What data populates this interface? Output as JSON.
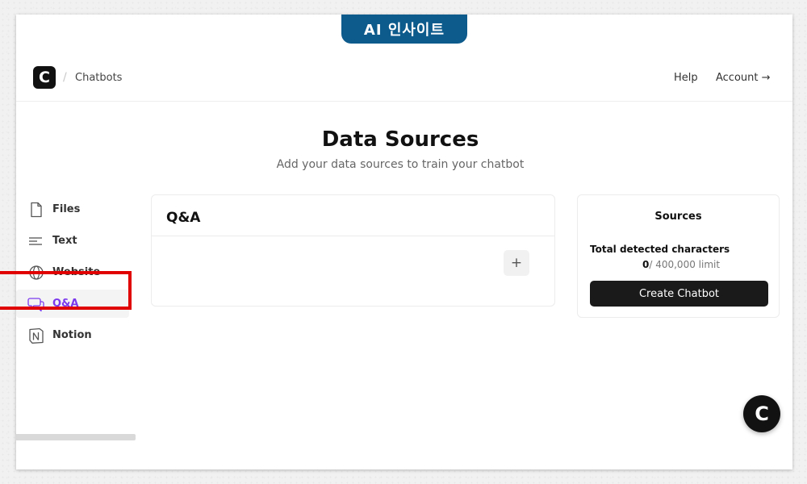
{
  "watermark": {
    "label": "AI 인사이트"
  },
  "topbar": {
    "logo_letter": "C",
    "separator": "/",
    "breadcrumb": "Chatbots",
    "help": "Help",
    "account": "Account →"
  },
  "header": {
    "title": "Data Sources",
    "subtitle": "Add your data sources to train your chatbot"
  },
  "sidebar": {
    "items": [
      {
        "label": "Files",
        "icon": "file-icon"
      },
      {
        "label": "Text",
        "icon": "text-lines-icon"
      },
      {
        "label": "Website",
        "icon": "globe-icon"
      },
      {
        "label": "Q&A",
        "icon": "chat-bubbles-icon",
        "active": true
      },
      {
        "label": "Notion",
        "icon": "notion-icon"
      }
    ]
  },
  "qa_panel": {
    "title": "Q&A",
    "add_label": "+"
  },
  "sources": {
    "title": "Sources",
    "chars_label": "Total detected characters",
    "count": "0",
    "limit": "/ 400,000 limit",
    "button": "Create Chatbot"
  },
  "chat_widget": {
    "letter": "C"
  },
  "colors": {
    "accent": "#7c3aed",
    "highlight": "#e00000",
    "brand_tab": "#0d5a8c",
    "button_dark": "#1a1a1a"
  }
}
